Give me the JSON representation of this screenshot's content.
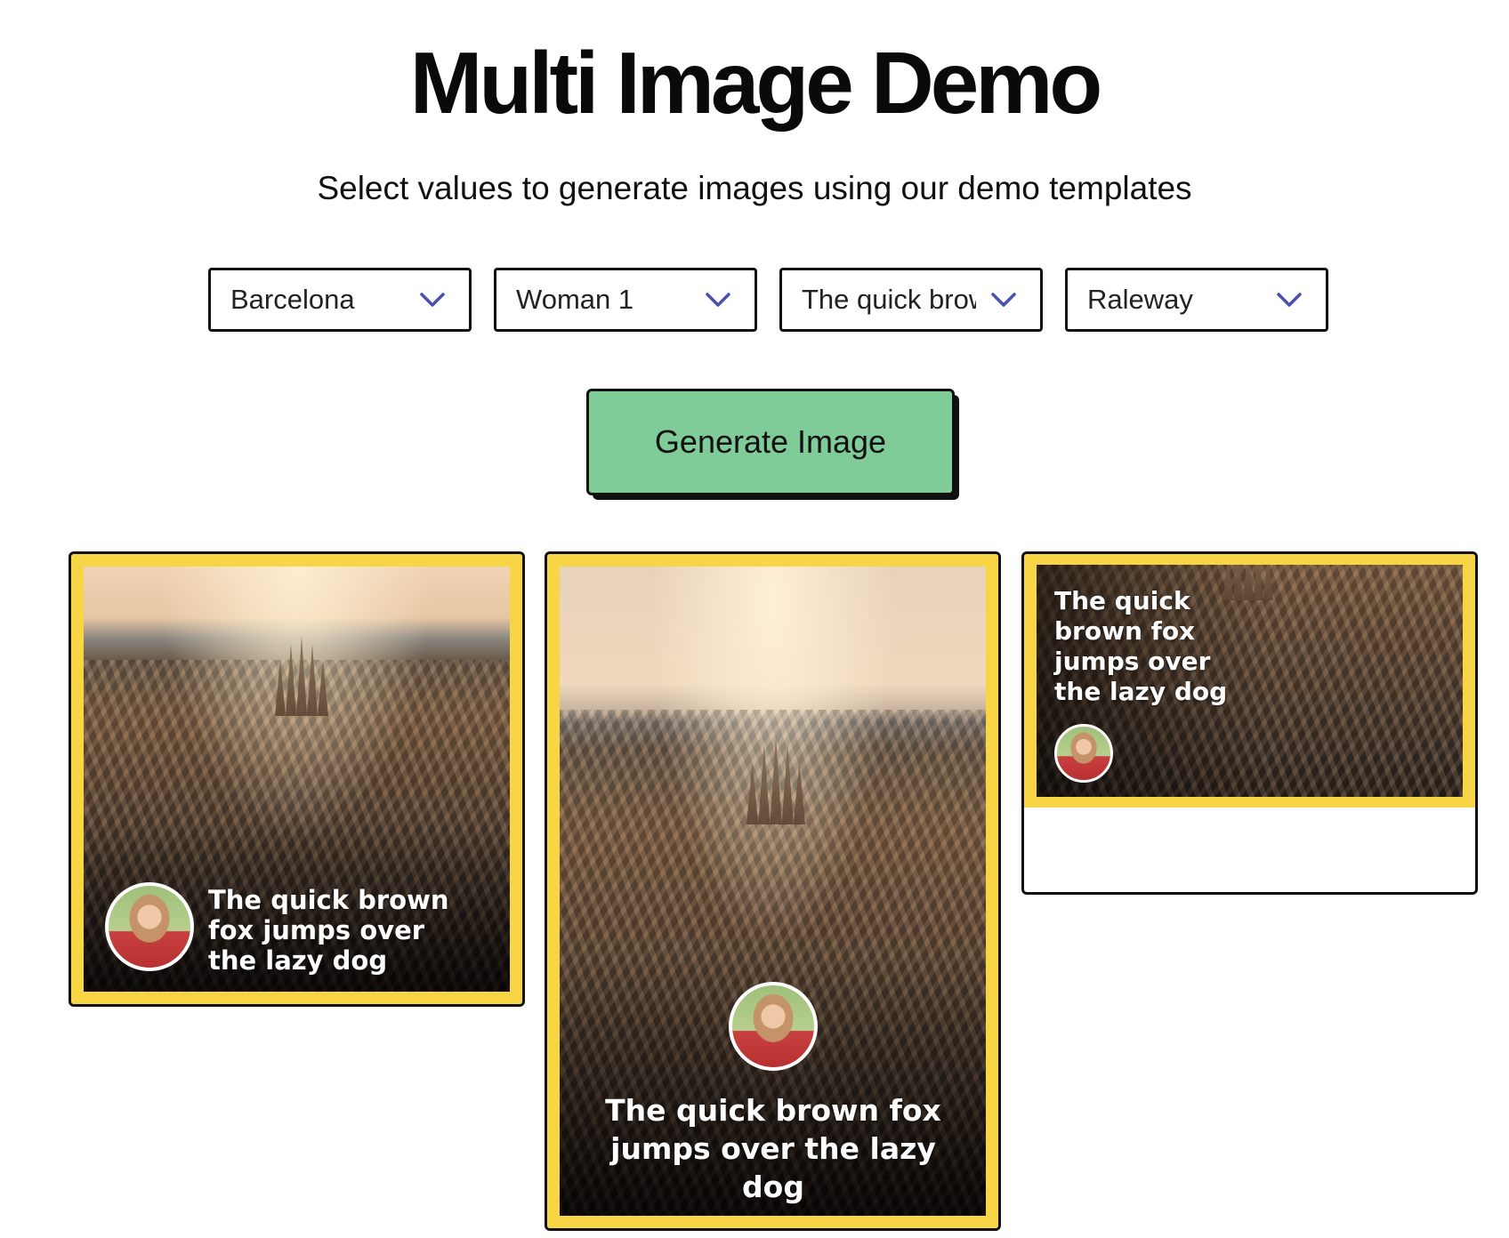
{
  "header": {
    "title": "Multi Image Demo",
    "subtitle": "Select values to generate images using our demo templates"
  },
  "selectors": {
    "location": "Barcelona",
    "person": "Woman 1",
    "text": "The quick brown fox jumps over the lazy dog",
    "font": "Raleway"
  },
  "actions": {
    "generate_label": "Generate Image"
  },
  "previews": [
    {
      "caption": "The quick brown fox jumps over the lazy dog"
    },
    {
      "caption": "The quick brown fox jumps over the lazy dog"
    },
    {
      "caption": "The quick brown fox jumps over the lazy dog"
    }
  ],
  "colors": {
    "accent_green": "#80cc99",
    "frame_yellow": "#f7d544",
    "chevron": "#4a4fb0",
    "border": "#111111"
  },
  "icons": {
    "dropdown": "chevron-down-icon"
  }
}
